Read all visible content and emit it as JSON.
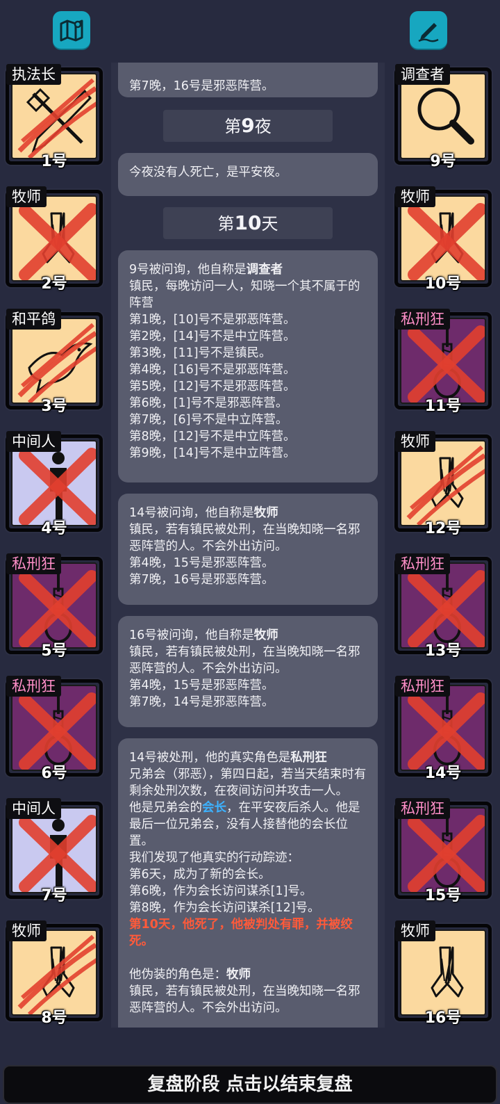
{
  "bottom_bar": {
    "label": "复盘阶段 点击以结束复盘"
  },
  "players_left": [
    {
      "role": "执法长",
      "number": "1号",
      "icon": "hammer-sword-icon",
      "dead": true,
      "mark": "claw",
      "faction": "town",
      "tag_color": "#ffffff"
    },
    {
      "role": "牧师",
      "number": "2号",
      "icon": "praying-hands-icon",
      "dead": true,
      "mark": "x",
      "faction": "town",
      "tag_color": "#ffffff"
    },
    {
      "role": "和平鸽",
      "number": "3号",
      "icon": "dove-icon",
      "dead": true,
      "mark": "claw",
      "faction": "town",
      "tag_color": "#ffffff"
    },
    {
      "role": "中间人",
      "number": "4号",
      "icon": "person-icon",
      "dead": true,
      "mark": "x",
      "faction": "neutral",
      "tag_color": "#ffffff"
    },
    {
      "role": "私刑狂",
      "number": "5号",
      "icon": "noose-icon",
      "dead": true,
      "mark": "x",
      "faction": "evil",
      "tag_color": "#ff8fc8"
    },
    {
      "role": "私刑狂",
      "number": "6号",
      "icon": "noose-icon",
      "dead": true,
      "mark": "x",
      "faction": "evil",
      "tag_color": "#ff8fc8"
    },
    {
      "role": "中间人",
      "number": "7号",
      "icon": "person-icon",
      "dead": true,
      "mark": "x",
      "faction": "neutral",
      "tag_color": "#ffffff"
    },
    {
      "role": "牧师",
      "number": "8号",
      "icon": "praying-hands-icon",
      "dead": true,
      "mark": "claw",
      "faction": "town",
      "tag_color": "#ffffff"
    }
  ],
  "players_right": [
    {
      "role": "调查者",
      "number": "9号",
      "icon": "magnifier-icon",
      "dead": false,
      "mark": "none",
      "faction": "town",
      "tag_color": "#ffffff"
    },
    {
      "role": "牧师",
      "number": "10号",
      "icon": "praying-hands-icon",
      "dead": true,
      "mark": "x",
      "faction": "town",
      "tag_color": "#ffffff"
    },
    {
      "role": "私刑狂",
      "number": "11号",
      "icon": "noose-icon",
      "dead": true,
      "mark": "x",
      "faction": "evil",
      "tag_color": "#ff8fc8"
    },
    {
      "role": "牧师",
      "number": "12号",
      "icon": "praying-hands-icon",
      "dead": true,
      "mark": "claw",
      "faction": "town",
      "tag_color": "#ffffff"
    },
    {
      "role": "私刑狂",
      "number": "13号",
      "icon": "noose-icon",
      "dead": true,
      "mark": "x",
      "faction": "evil",
      "tag_color": "#ff8fc8"
    },
    {
      "role": "私刑狂",
      "number": "14号",
      "icon": "noose-icon",
      "dead": true,
      "mark": "x",
      "faction": "evil",
      "tag_color": "#ff8fc8"
    },
    {
      "role": "私刑狂",
      "number": "15号",
      "icon": "noose-icon",
      "dead": true,
      "mark": "x",
      "faction": "evil",
      "tag_color": "#ff8fc8"
    },
    {
      "role": "牧师",
      "number": "16号",
      "icon": "praying-hands-icon",
      "dead": false,
      "mark": "none",
      "faction": "town",
      "tag_color": "#ffffff"
    }
  ],
  "log": {
    "partial_top": "第7晚，16号是邪恶阵营。",
    "night9": {
      "prefix": "第",
      "num": "9",
      "suffix": "夜"
    },
    "night9_msg": "今夜没有人死亡，是平安夜。",
    "day10": {
      "prefix": "第",
      "num": "10",
      "suffix": "天"
    },
    "msg1": {
      "lead": "9号被问询，他自称是",
      "role": "调查者",
      "body": "镇民，每晚访问一人，知晓一个其不属于的阵营\n第1晚，[10]号不是邪恶阵营。\n第2晚，[14]号不是中立阵营。\n第3晚，[11]号不是镇民。\n第4晚，[16]号不是邪恶阵营。\n第5晚，[12]号不是邪恶阵营。\n第6晚，[1]号不是邪恶阵营。\n第7晚，[6]号不是中立阵营。\n第8晚，[12]号不是中立阵营。\n第9晚，[14]号不是中立阵营。"
    },
    "msg2": {
      "lead": "14号被问询，他自称是",
      "role": "牧师",
      "body": "镇民，若有镇民被处刑，在当晚知晓一名邪恶阵营的人。不会外出访问。\n第4晚，15号是邪恶阵营。\n第7晚，16号是邪恶阵营。"
    },
    "msg3": {
      "lead": "16号被问询，他自称是",
      "role": "牧师",
      "body": "镇民，若有镇民被处刑，在当晚知晓一名邪恶阵营的人。不会外出访问。\n第4晚，15号是邪恶阵营。\n第7晚，14号是邪恶阵营。"
    },
    "msg4": {
      "lead": "14号被处刑，他的真实角色是",
      "role": "私刑狂",
      "body1": "兄弟会（邪恶），第四日起，若当天结束时有剩余处刑次数，在夜间访问并攻击一人。\n他是兄弟会的",
      "link": "会长",
      "body2": "，在平安夜后杀人。他是最后一位兄弟会，没有人接替他的会长位置。\n我们发现了他真实的行动踪迹：\n第6天，成为了新的会长。\n第6晚，作为会长访问谋杀[1]号。\n第8晚，作为会长访问谋杀[12]号。",
      "death": "第10天，他死了，他被判处有罪，并被绞死。",
      "fake_lead": "他伪装的角色是：",
      "fake_role": "牧师",
      "fake_body": "镇民，若有镇民被处刑，在当晚知晓一名邪恶阵营的人。不会外出访问。"
    }
  },
  "colors": {
    "background": "#272a3f",
    "bubble": "#595c6e",
    "accent_blue": "#3db2ff",
    "accent_red": "#ff5a3a",
    "icon_button": "#17a7c0"
  }
}
